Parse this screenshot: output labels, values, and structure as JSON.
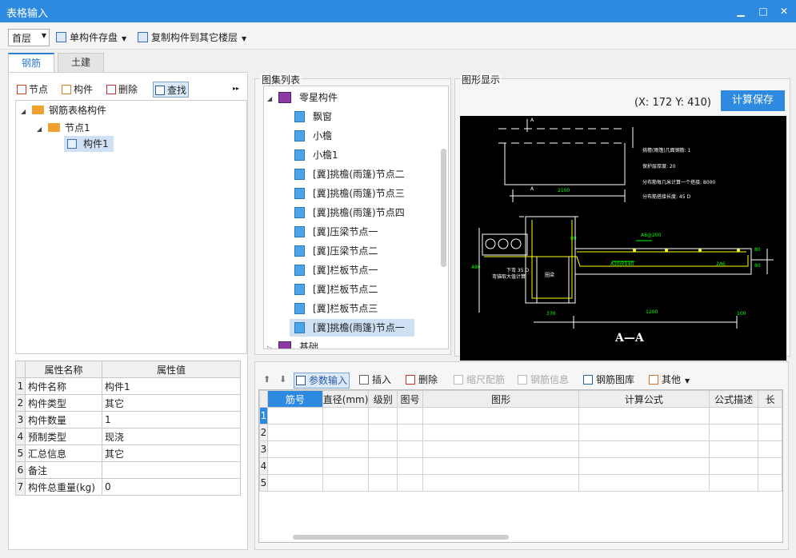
{
  "window": {
    "title": "表格输入",
    "min_glyph": "▁",
    "max_glyph": "□",
    "close_glyph": "✕"
  },
  "topbar": {
    "floor_value": "首层",
    "save_label": "单构件存盘",
    "copy_label": "复制构件到其它楼层"
  },
  "tabs": [
    {
      "label": "钢筋"
    },
    {
      "label": "土建"
    }
  ],
  "left_toolbar": {
    "node": "节点",
    "component": "构件",
    "delete": "删除",
    "find": "查找",
    "more": "▸▸"
  },
  "tree": {
    "root": "钢筋表格构件",
    "node1": "节点1",
    "comp1": "构件1"
  },
  "props": {
    "header_name": "属性名称",
    "header_value": "属性值",
    "rows": [
      {
        "n": "1",
        "name": "构件名称",
        "value": "构件1"
      },
      {
        "n": "2",
        "name": "构件类型",
        "value": "其它"
      },
      {
        "n": "3",
        "name": "构件数量",
        "value": "1"
      },
      {
        "n": "4",
        "name": "预制类型",
        "value": "现浇"
      },
      {
        "n": "5",
        "name": "汇总信息",
        "value": "其它"
      },
      {
        "n": "6",
        "name": "备注",
        "value": ""
      },
      {
        "n": "7",
        "name": "构件总重量(kg)",
        "value": "0"
      }
    ]
  },
  "atlas": {
    "title": "图集列表",
    "group1": "零星构件",
    "items": [
      "飘窗",
      "小檐",
      "小檐1",
      "[冀]挑檐(雨篷)节点二",
      "[冀]挑檐(雨篷)节点三",
      "[冀]挑檐(雨篷)节点四",
      "[冀]压梁节点一",
      "[冀]压梁节点二",
      "[冀]栏板节点一",
      "[冀]栏板节点二",
      "[冀]栏板节点三",
      "[冀]挑檐(雨篷)节点一"
    ],
    "group2": "基础"
  },
  "graphic": {
    "title": "图形显示",
    "coord": "(X: 172 Y: 410)",
    "calc_save": "计算保存",
    "cad": {
      "section": "A—A",
      "dim_2100": "2100",
      "dim_1200": "1200",
      "dim_370": "370",
      "dim_100": "100",
      "mark_a": "A",
      "mark_a2": "A",
      "rebar1": "A6@200",
      "rebar2": "A10@140",
      "rebar3": "2A6",
      "beam": "圈梁",
      "note1": "挑檐(雨篷)几面钢筋:   1",
      "note2": "保护层厚度:   20",
      "note3": "分布筋每几米计算一个搭接:   8000",
      "note4": "分布筋搭接长度:   45 D",
      "note5": "下弯 35 D",
      "note6": "弯锚取大值计算",
      "dim_480": "480",
      "dim_80": "80",
      "dim_80b": "80",
      "dim_80c": "80"
    }
  },
  "rebar_toolbar": {
    "param_input": "参数输入",
    "insert": "插入",
    "delete": "删除",
    "scale": "缩尺配筋",
    "info": "钢筋信息",
    "library": "钢筋图库",
    "other": "其他"
  },
  "rebar_grid": {
    "headers": [
      "筋号",
      "直径(mm)",
      "级别",
      "图号",
      "图形",
      "计算公式",
      "公式描述",
      "长"
    ],
    "rows": [
      "1",
      "2",
      "3",
      "4",
      "5"
    ]
  }
}
